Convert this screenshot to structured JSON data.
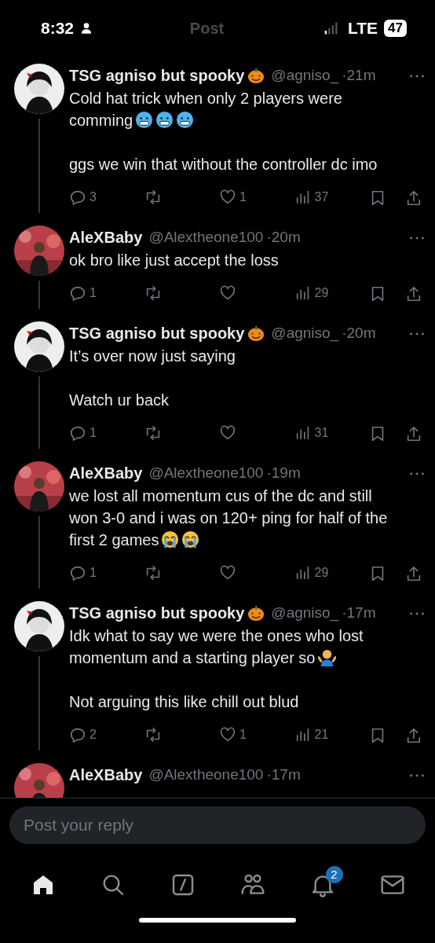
{
  "status_bar": {
    "time": "8:32",
    "network": "LTE",
    "battery": "47"
  },
  "header": {
    "title": "Post"
  },
  "posts": [
    {
      "avatar": {
        "kind": "dark"
      },
      "name": "TSG agniso but spooky",
      "name_emoji": true,
      "handle": "@agniso_",
      "time": "·21m",
      "paragraphs": [
        {
          "lines": [
            {
              "text": "Cold hat trick when only 2 players were"
            },
            {
              "text": "comming",
              "emojis": [
                {
                  "kind": "cold"
                },
                {
                  "kind": "cold"
                },
                {
                  "kind": "cold"
                }
              ]
            }
          ]
        },
        {
          "lines": [
            {
              "text": "ggs we win that without the controller dc imo"
            }
          ]
        }
      ],
      "replies": "3",
      "likes": "1",
      "views": "37"
    },
    {
      "avatar": {
        "kind": "red"
      },
      "name": "AleXBaby",
      "handle": "@Alextheone100",
      "time": "·20m",
      "paragraphs": [
        {
          "lines": [
            {
              "text": "ok bro like just accept the loss"
            }
          ]
        }
      ],
      "replies": "1",
      "views": "29"
    },
    {
      "avatar": {
        "kind": "dark"
      },
      "name": "TSG agniso but spooky",
      "name_emoji": true,
      "handle": "@agniso_",
      "time": "·20m",
      "paragraphs": [
        {
          "lines": [
            {
              "text": "It’s over now just saying"
            }
          ]
        },
        {
          "lines": [
            {
              "text": "Watch ur back"
            }
          ]
        }
      ],
      "replies": "1",
      "views": "31"
    },
    {
      "avatar": {
        "kind": "red"
      },
      "name": "AleXBaby",
      "handle": "@Alextheone100",
      "time": "·19m",
      "paragraphs": [
        {
          "lines": [
            {
              "text": "we lost all momentum cus of the dc and still"
            },
            {
              "text": "won 3-0 and i was on 120+ ping for half of the"
            },
            {
              "text": "first 2 games",
              "emojis": [
                {
                  "kind": "cry"
                },
                {
                  "kind": "cry"
                }
              ]
            }
          ]
        }
      ],
      "replies": "1",
      "views": "29"
    },
    {
      "avatar": {
        "kind": "dark"
      },
      "name": "TSG agniso but spooky",
      "name_emoji": true,
      "handle": "@agniso_",
      "time": "·17m",
      "paragraphs": [
        {
          "lines": [
            {
              "text": "Idk what to say we were the ones who lost"
            },
            {
              "text": "momentum and a starting player so",
              "emojis": [
                {
                  "kind": "shrug"
                }
              ]
            }
          ]
        },
        {
          "lines": [
            {
              "text": "Not arguing this like chill out blud"
            }
          ]
        }
      ],
      "replies": "2",
      "likes": "1",
      "views": "21"
    },
    {
      "avatar": {
        "kind": "red"
      },
      "name": "AleXBaby",
      "handle": "@Alextheone100",
      "time": "·17m"
    }
  ],
  "reply": {
    "placeholder": "Post your reply"
  },
  "tabs": [
    {
      "kind": "home",
      "selected": true
    },
    {
      "kind": "search",
      "selected": false
    },
    {
      "kind": "compose",
      "selected": false
    },
    {
      "kind": "people",
      "selected": false
    },
    {
      "kind": "bell",
      "selected": false,
      "badge": "2"
    },
    {
      "kind": "mail",
      "selected": false
    }
  ]
}
